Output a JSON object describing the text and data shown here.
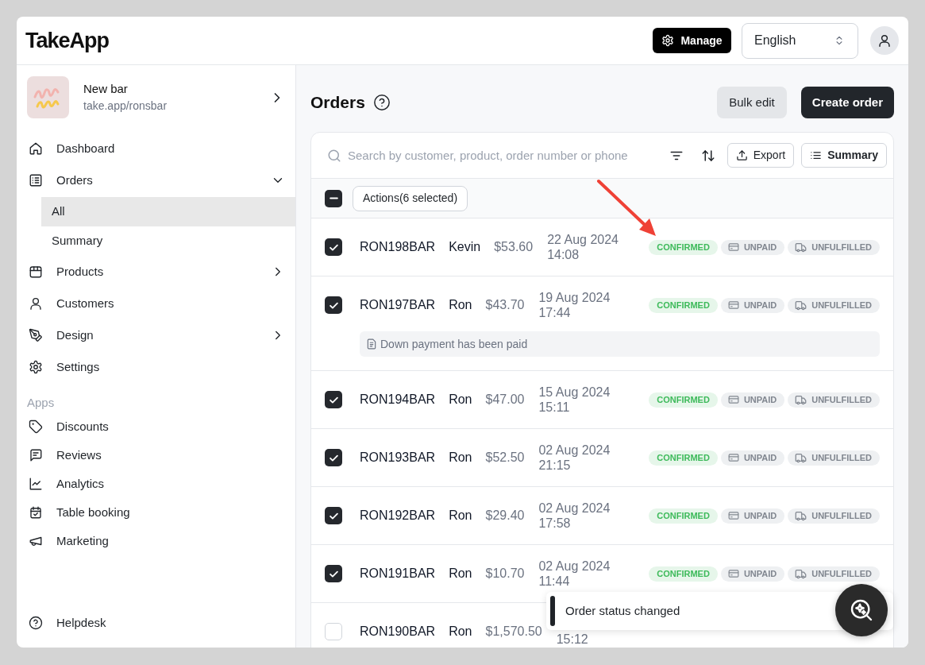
{
  "header": {
    "logo": "TakeApp",
    "manage_button": "Manage",
    "language": "English"
  },
  "store": {
    "name": "New bar",
    "url": "take.app/ronsbar"
  },
  "nav": [
    {
      "label": "Dashboard",
      "kind": "link",
      "selected": false
    },
    {
      "label": "Orders",
      "kind": "group",
      "expanded": true,
      "selected": false,
      "children": [
        {
          "label": "All",
          "selected": true
        },
        {
          "label": "Summary",
          "selected": false
        }
      ]
    },
    {
      "label": "Products",
      "kind": "group",
      "expanded": false,
      "selected": false
    },
    {
      "label": "Customers",
      "kind": "link",
      "selected": false
    },
    {
      "label": "Design",
      "kind": "group",
      "expanded": false,
      "selected": false
    },
    {
      "label": "Settings",
      "kind": "link",
      "selected": false
    }
  ],
  "apps": {
    "title": "Apps",
    "items": [
      {
        "label": "Discounts",
        "selected": false
      },
      {
        "label": "Reviews",
        "selected": false
      },
      {
        "label": "Analytics",
        "selected": false
      },
      {
        "label": "Table booking",
        "selected": false
      },
      {
        "label": "Marketing",
        "selected": false
      }
    ]
  },
  "helpdesk": {
    "label": "Helpdesk"
  },
  "orders": {
    "title": "Orders",
    "buttons": [
      {
        "label": "Bulk edit",
        "kind": "secondary"
      },
      {
        "label": "Create order",
        "kind": "primary"
      }
    ],
    "search": {
      "placeholder": "Search by customer, product, order number or phone"
    },
    "tools": [
      {
        "label": "Export"
      },
      {
        "label": "Summary"
      }
    ],
    "select_all": {
      "indeterminate": true
    },
    "actions_button": "Actions(6 selected)",
    "rows": [
      {
        "id": "RON198BAR",
        "customer": "Kevin",
        "total": "$53.60",
        "date": "22 Aug 2024",
        "time": "14:08",
        "selected": true,
        "badges": [
          {
            "kind": "status",
            "label": "CONFIRMED"
          },
          {
            "kind": "payment",
            "label": "UNPAID"
          },
          {
            "kind": "fulfillment",
            "label": "UNFULFILLED"
          }
        ]
      },
      {
        "id": "RON197BAR",
        "customer": "Ron",
        "total": "$43.70",
        "date": "19 Aug 2024",
        "time": "17:44",
        "selected": true,
        "badges": [
          {
            "kind": "status",
            "label": "CONFIRMED"
          },
          {
            "kind": "payment",
            "label": "UNPAID"
          },
          {
            "kind": "fulfillment",
            "label": "UNFULFILLED"
          }
        ],
        "note": "Down payment has been paid"
      },
      {
        "id": "RON194BAR",
        "customer": "Ron",
        "total": "$47.00",
        "date": "15 Aug 2024",
        "time": "15:11",
        "selected": true,
        "badges": [
          {
            "kind": "status",
            "label": "CONFIRMED"
          },
          {
            "kind": "payment",
            "label": "UNPAID"
          },
          {
            "kind": "fulfillment",
            "label": "UNFULFILLED"
          }
        ]
      },
      {
        "id": "RON193BAR",
        "customer": "Ron",
        "total": "$52.50",
        "date": "02 Aug 2024",
        "time": "21:15",
        "selected": true,
        "badges": [
          {
            "kind": "status",
            "label": "CONFIRMED"
          },
          {
            "kind": "payment",
            "label": "UNPAID"
          },
          {
            "kind": "fulfillment",
            "label": "UNFULFILLED"
          }
        ]
      },
      {
        "id": "RON192BAR",
        "customer": "Ron",
        "total": "$29.40",
        "date": "02 Aug 2024",
        "time": "17:58",
        "selected": true,
        "badges": [
          {
            "kind": "status",
            "label": "CONFIRMED"
          },
          {
            "kind": "payment",
            "label": "UNPAID"
          },
          {
            "kind": "fulfillment",
            "label": "UNFULFILLED"
          }
        ]
      },
      {
        "id": "RON191BAR",
        "customer": "Ron",
        "total": "$10.70",
        "date": "02 Aug 2024",
        "time": "11:44",
        "selected": true,
        "badges": [
          {
            "kind": "status",
            "label": "CONFIRMED"
          },
          {
            "kind": "payment",
            "label": "UNPAID"
          },
          {
            "kind": "fulfillment",
            "label": "UNFULFILLED"
          }
        ]
      },
      {
        "id": "RON190BAR",
        "customer": "Ron",
        "total": "$1,570.50",
        "time": "15:12",
        "selected": false
      }
    ]
  },
  "toast": {
    "message": "Order status changed"
  }
}
